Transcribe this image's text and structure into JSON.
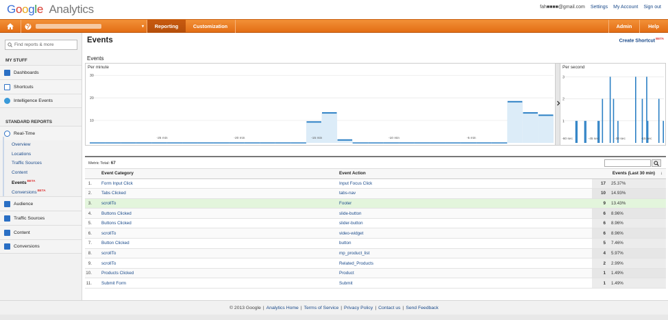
{
  "app": {
    "logo_google": "Google",
    "logo_product": "Analytics"
  },
  "account_bar": {
    "email": "fah■■■■@gmail.com",
    "settings": "Settings",
    "my_account": "My Account",
    "sign_out": "Sign out"
  },
  "nav": {
    "account_selector_caret": "▾",
    "reporting": "Reporting",
    "customization": "Customization",
    "admin": "Admin",
    "help": "Help"
  },
  "sidebar": {
    "search_placeholder": "Find reports & more",
    "my_stuff_heading": "MY STUFF",
    "dashboards": "Dashboards",
    "shortcuts": "Shortcuts",
    "intelligence_events": "Intelligence Events",
    "standard_reports_heading": "STANDARD REPORTS",
    "real_time": "Real-Time",
    "rt_items": [
      {
        "label": "Overview"
      },
      {
        "label": "Locations"
      },
      {
        "label": "Traffic Sources"
      },
      {
        "label": "Content"
      },
      {
        "label": "Events",
        "beta": "BETA"
      },
      {
        "label": "Conversions",
        "beta": "BETA"
      }
    ],
    "audience": "Audience",
    "traffic_sources": "Traffic Sources",
    "content": "Content",
    "conversions": "Conversions"
  },
  "page": {
    "title": "Events",
    "shortcut": "Create Shortcut",
    "shortcut_badge": "BETA",
    "chart_heading": "Events",
    "per_minute_label": "Per minute",
    "per_second_label": "Per second",
    "metric_total_label": "Metric Total:",
    "metric_total_value": "67",
    "search_icon": "magnifier-icon",
    "sort_icon": "↓"
  },
  "chart_data": [
    {
      "type": "area",
      "title": "Per minute",
      "x_ticks": [
        "-25 min",
        "-20 min",
        "-15 min",
        "-10 min",
        "-5 min"
      ],
      "y_ticks": [
        10,
        20,
        30
      ],
      "ylim": [
        0,
        30
      ],
      "series": [
        {
          "values": [
            0,
            0,
            0,
            0,
            0,
            0,
            0,
            0,
            0,
            0,
            0,
            0,
            0,
            0,
            9,
            13,
            1,
            0,
            0,
            0,
            0,
            0,
            0,
            0,
            0,
            0,
            0,
            18,
            13,
            12
          ]
        }
      ]
    },
    {
      "type": "bar",
      "title": "Per second",
      "x_ticks": [
        "-60 sec",
        "-45 sec",
        "-30 sec",
        "-15 sec"
      ],
      "y_ticks": [
        1,
        2,
        3
      ],
      "ylim": [
        0,
        3
      ],
      "series": [
        {
          "values": [
            0,
            0,
            0,
            0,
            0,
            0,
            0,
            0,
            0,
            0,
            0,
            1,
            1,
            0,
            0,
            0,
            0,
            0,
            0,
            1,
            1,
            0,
            0,
            0,
            0,
            0,
            0,
            0,
            0,
            0,
            0,
            1,
            1,
            0,
            0,
            2,
            0,
            0,
            0,
            0,
            0,
            0,
            3,
            0,
            0,
            2,
            0,
            0,
            0,
            1,
            0,
            0,
            0,
            0,
            0,
            0,
            0,
            0,
            0,
            0,
            0,
            0,
            0,
            0,
            0,
            3,
            0,
            0,
            0,
            0,
            0,
            2,
            0,
            0,
            0,
            3,
            1,
            0,
            0,
            0,
            0,
            0,
            0,
            0,
            0,
            0,
            2,
            0,
            0,
            0,
            1
          ]
        }
      ]
    }
  ],
  "table": {
    "col_category": "Event Category",
    "col_action": "Event Action",
    "col_events": "Events (Last 30 min)",
    "rows": [
      {
        "n": "1.",
        "category": "Form Input Click",
        "action": "Input Focus Click",
        "events": "17",
        "pct": "25.37%"
      },
      {
        "n": "2.",
        "category": "Tabs Clicked",
        "action": "tabs-nav",
        "events": "10",
        "pct": "14.93%"
      },
      {
        "n": "3.",
        "category": "scrollTo",
        "action": "Footer",
        "events": "9",
        "pct": "13.43%"
      },
      {
        "n": "4.",
        "category": "Buttons Clicked",
        "action": "slide-button",
        "events": "6",
        "pct": "8.96%"
      },
      {
        "n": "5.",
        "category": "Buttons Clicked",
        "action": "slider-button",
        "events": "6",
        "pct": "8.96%"
      },
      {
        "n": "6.",
        "category": "scrollTo",
        "action": "video-widget",
        "events": "6",
        "pct": "8.96%"
      },
      {
        "n": "7.",
        "category": "Button Clicked",
        "action": "button",
        "events": "5",
        "pct": "7.46%"
      },
      {
        "n": "8.",
        "category": "scrollTo",
        "action": "mp_product_list",
        "events": "4",
        "pct": "5.97%"
      },
      {
        "n": "9.",
        "category": "scrollTo",
        "action": "Related_Products",
        "events": "2",
        "pct": "2.99%"
      },
      {
        "n": "10.",
        "category": "Products Clicked",
        "action": "Product",
        "events": "1",
        "pct": "1.49%"
      },
      {
        "n": "11.",
        "category": "Submit Form",
        "action": "Submit",
        "events": "1",
        "pct": "1.49%"
      }
    ]
  },
  "footer": {
    "copyright": "© 2013 Google",
    "links": [
      "Analytics Home",
      "Terms of Service",
      "Privacy Policy",
      "Contact us",
      "Send Feedback"
    ]
  },
  "colors": {
    "nav_orange": "#ea7a22",
    "chart_line": "#2a7fc4",
    "chart_fill": "#dcecf8",
    "row_highlight": "#e3f5dc"
  }
}
